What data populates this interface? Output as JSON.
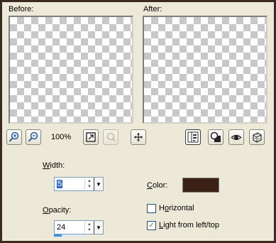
{
  "preview": {
    "before_label": "Before:",
    "after_label": "After:"
  },
  "toolbar": {
    "zoom_in_icon": "zoom-in-icon",
    "zoom_out_icon": "zoom-out-icon",
    "zoom_level": "100%",
    "zoom_to_fit_icon": "zoom-fit-icon",
    "zoom_to_selection_icon": "zoom-selection-icon",
    "pan_icon": "pan-icon",
    "proof_icon": "proof-icon",
    "mask_icon": "mask-icon",
    "eye_icon": "eye-icon",
    "randomize_icon": "dice-icon"
  },
  "settings": {
    "width_label": "Width:",
    "width_value": "5",
    "opacity_label": "Opacity:",
    "opacity_value": "24",
    "opacity_fraction": 0.24,
    "color_label": "Color:",
    "color_value": "#3b2115",
    "horizontal_label": "Horizontal",
    "horizontal_checked": false,
    "light_label": "Light from left/top",
    "light_checked": true
  }
}
